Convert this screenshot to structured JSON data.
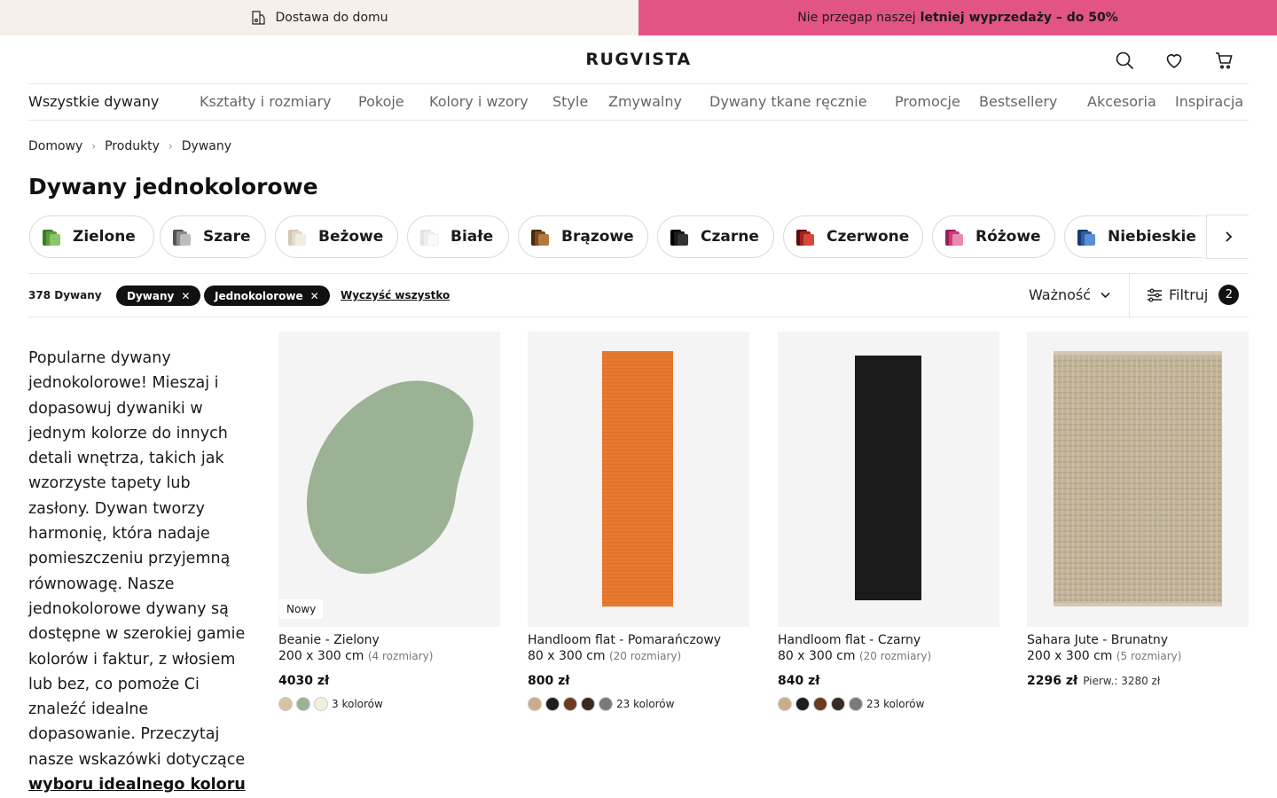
{
  "promo": {
    "delivery": "Dostawa do domu",
    "sale_prefix": "Nie przegap naszej",
    "sale_bold": "letniej wyprzedaży – do 50%"
  },
  "header": {
    "logo": "RUGVISTA"
  },
  "nav": [
    "Wszystkie dywany",
    "Kształty i rozmiary",
    "Pokoje",
    "Kolory i wzory",
    "Style",
    "Zmywalny",
    "Dywany tkane ręcznie",
    "Promocje",
    "Bestsellery",
    "Akcesoria",
    "Inspiracja"
  ],
  "breadcrumb": [
    "Domowy",
    "Produkty",
    "Dywany"
  ],
  "page_title": "Dywany jednokolorowe",
  "color_chips": [
    {
      "label": "Zielone",
      "color": "#5a9e3c"
    },
    {
      "label": "Szare",
      "color": "#7a7a7a"
    },
    {
      "label": "Beżowe",
      "color": "#e2d6c8"
    },
    {
      "label": "Białe",
      "color": "#f0f0f0"
    },
    {
      "label": "Brązowe",
      "color": "#7a4a1c"
    },
    {
      "label": "Czarne",
      "color": "#1a1a1a"
    },
    {
      "label": "Czerwone",
      "color": "#a32020"
    },
    {
      "label": "Różowe",
      "color": "#c8407a"
    },
    {
      "label": "Niebieskie",
      "color": "#2b5ea8"
    }
  ],
  "filterbar": {
    "count": "378 Dywany",
    "tags": [
      "Dywany",
      "Jednokolorowe"
    ],
    "clear_all": "Wyczyść wszystko",
    "sort_label": "Ważność",
    "filter_label": "Filtruj",
    "filter_count": "2"
  },
  "intro": {
    "text": "Popularne dywany jednokolorowe! Mieszaj i dopasowuj dywaniki w jednym kolorze do innych detali wnętrza, takich jak wzorzyste tapety lub zasłony. Dywan tworzy harmonię, która nadaje pomieszczeniu przyjemną równowagę. Nasze jednokolorowe dywany są dostępne w szerokiej gamie kolorów i faktur, z włosiem lub bez, co pomoże Ci znaleźć idealne dopasowanie. Przeczytaj nasze wskazówki dotyczące",
    "link": "wyboru idealnego koloru"
  },
  "products": [
    {
      "name": "Beanie - Zielony",
      "size": "200 x 300 cm",
      "more": "(4 rozmiary)",
      "price": "4030 zł",
      "orig": "",
      "badge": "Nowy",
      "rug_color": "#9cb294",
      "swatches": [
        "#d8c2a0",
        "#9cb294",
        "#f2efe0"
      ],
      "colors_label": "3 kolorów"
    },
    {
      "name": "Handloom flat - Pomarańczowy",
      "size": "80 x 300 cm",
      "more": "(20 rozmiary)",
      "price": "800 zł",
      "orig": "",
      "badge": "",
      "rug_color": "#e87a30",
      "swatches": [
        "#c9ad8a",
        "#1e1e1e",
        "#6b3b22",
        "#3a2a22",
        "#7a7a7a"
      ],
      "colors_label": "23 kolorów"
    },
    {
      "name": "Handloom flat - Czarny",
      "size": "80 x 300 cm",
      "more": "(20 rozmiary)",
      "price": "840 zł",
      "orig": "",
      "badge": "",
      "rug_color": "#1b1b1b",
      "swatches": [
        "#c9ad8a",
        "#1e1e1e",
        "#6b3b22",
        "#3a2a22",
        "#7a7a7a"
      ],
      "colors_label": "23 kolorów"
    },
    {
      "name": "Sahara Jute - Brunatny",
      "size": "200 x 300 cm",
      "more": "(5 rozmiary)",
      "price": "2296 zł",
      "orig": "Pierw.: 3280 zł",
      "badge": "",
      "rug_color": "#c2b49a",
      "swatches": [],
      "colors_label": ""
    }
  ]
}
